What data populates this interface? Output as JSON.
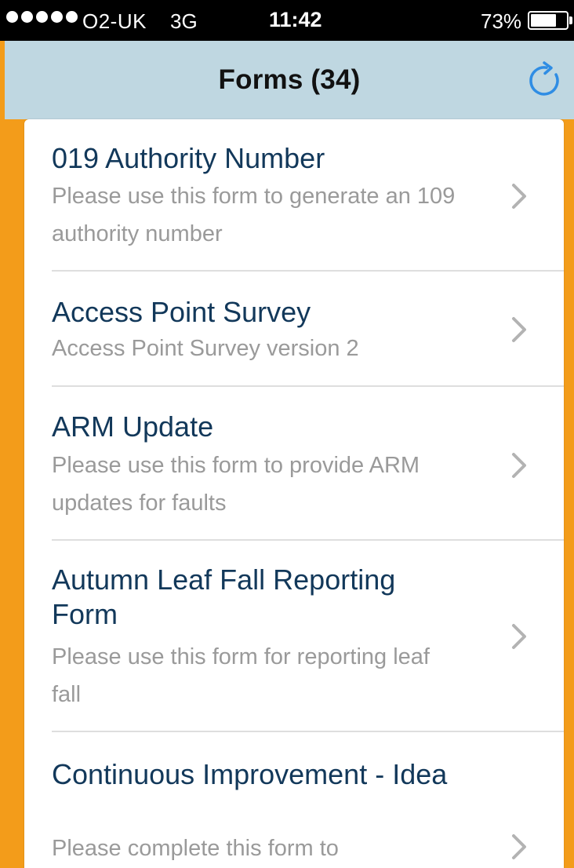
{
  "status_bar": {
    "carrier": "O2-UK",
    "network": "3G",
    "time": "11:42",
    "battery_percent": "73%",
    "battery_level": 0.73,
    "signal_bars": 5
  },
  "nav": {
    "title": "Forms (34)",
    "refresh_icon": "refresh-icon",
    "accent": "#2f8de4"
  },
  "forms": [
    {
      "title": "019 Authority Number",
      "subtitle": "Please use this form to generate an 109 authority number"
    },
    {
      "title": "Access Point Survey",
      "subtitle": "Access Point Survey version 2"
    },
    {
      "title": "ARM Update",
      "subtitle": "Please use this form to provide ARM updates for faults"
    },
    {
      "title": "Autumn Leaf Fall Reporting Form",
      "subtitle": "Please use this form for reporting leaf fall"
    },
    {
      "title": "Continuous Improvement - Idea",
      "subtitle": "Please complete this form to"
    }
  ],
  "colors": {
    "background_orange": "#f39c1a",
    "nav_bar": "#bfd7e1",
    "title_text": "#12385a",
    "subtitle_text": "#9a9a9a"
  }
}
